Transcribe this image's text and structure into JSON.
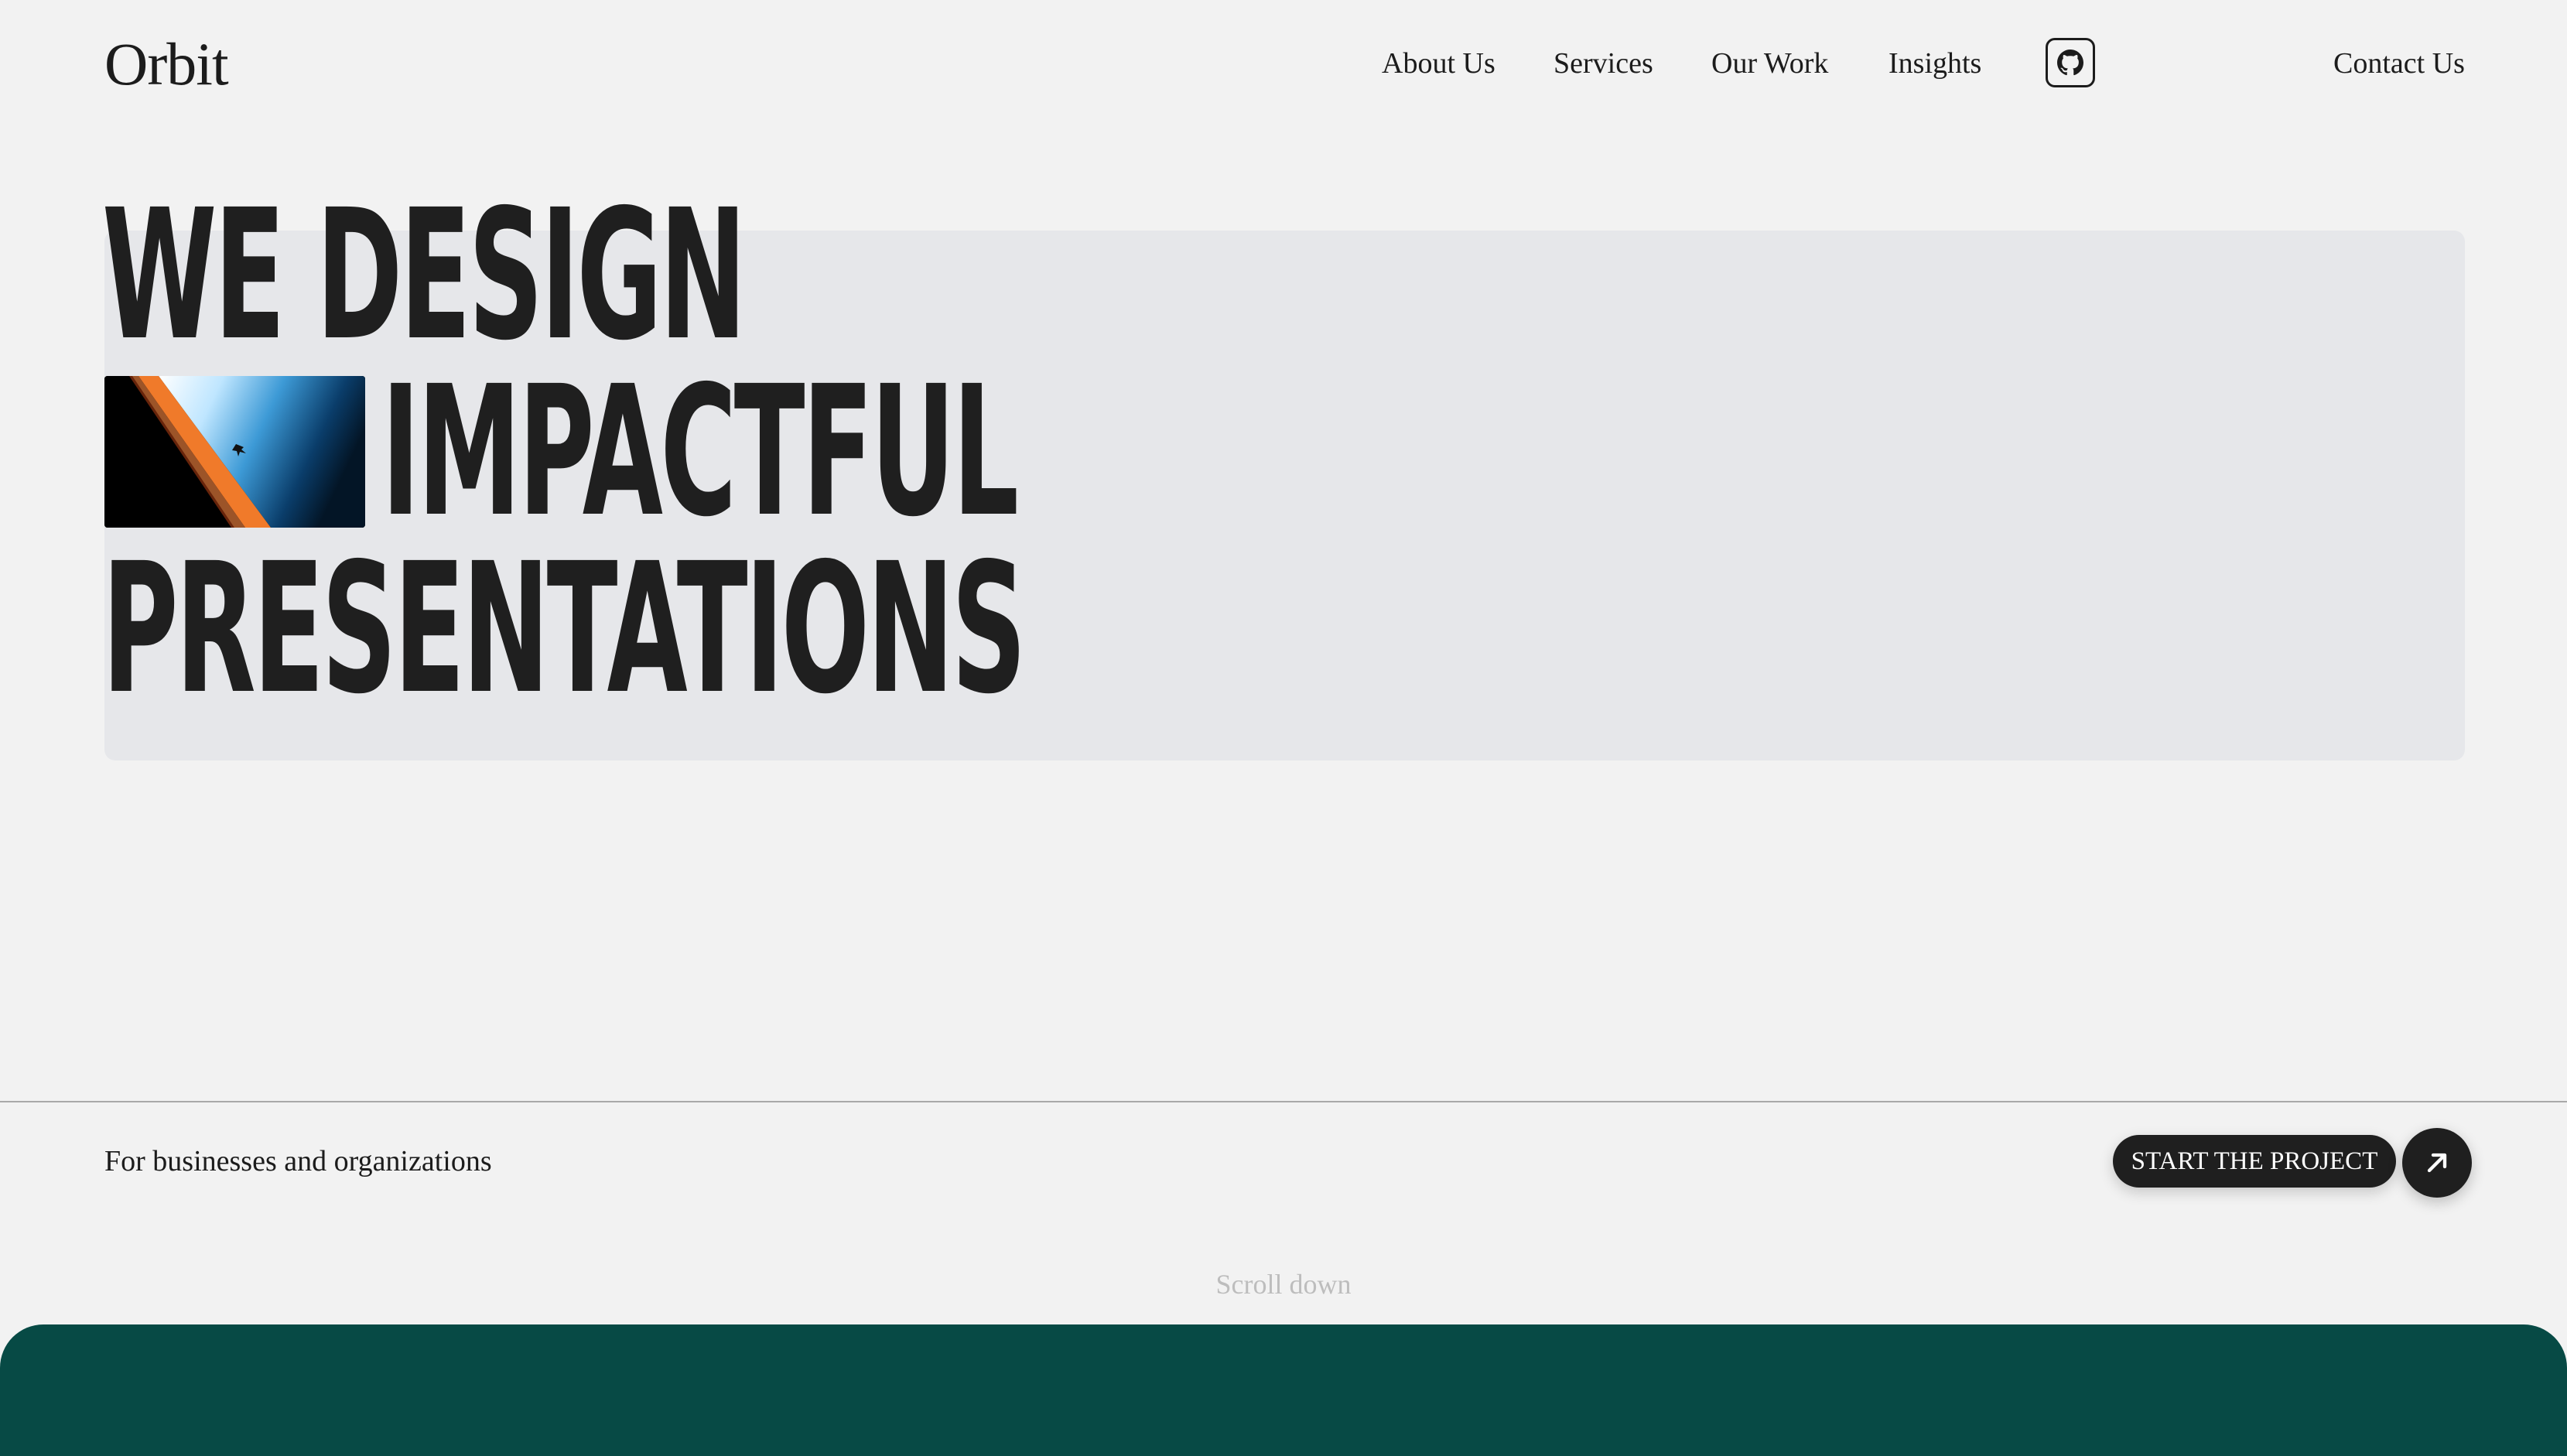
{
  "brand": {
    "name": "Orbit"
  },
  "nav": {
    "items": [
      {
        "label": "About Us"
      },
      {
        "label": "Services"
      },
      {
        "label": "Our Work"
      },
      {
        "label": "Insights"
      }
    ],
    "github_icon": "github-icon",
    "contact_label": "Contact Us"
  },
  "hero": {
    "line1": "WE DESIGN",
    "line2": "IMPACTFUL",
    "line3": "PRESENTATIONS",
    "image_icon": "earth-horizon-image"
  },
  "footer_bar": {
    "tagline": "For businesses and organizations",
    "cta_label": "START THE PROJECT",
    "cta_icon": "arrow-up-right-icon",
    "scroll_hint": "Scroll down"
  },
  "colors": {
    "background": "#f2f2f2",
    "hero_panel": "#e6e7ea",
    "text": "#1f1f1f",
    "button": "#1f1f1f",
    "section_green": "#074a45",
    "muted_text": "#bdbdbd"
  }
}
